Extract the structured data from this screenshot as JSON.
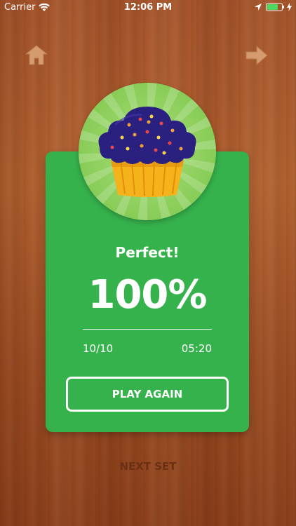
{
  "status_bar": {
    "carrier": "Carrier",
    "time": "12:06 PM",
    "battery_level": 0.85,
    "icons": [
      "wifi-icon",
      "location-icon",
      "battery-icon",
      "charging-icon"
    ]
  },
  "nav": {
    "home_icon": "home-icon",
    "next_icon": "arrow-right-icon"
  },
  "badge": {
    "icon": "cupcake-icon"
  },
  "result": {
    "label": "Perfect!",
    "score": "100%",
    "correct": "10/10",
    "time": "05:20"
  },
  "actions": {
    "play_again": "PLAY AGAIN",
    "next_set": "NEXT SET"
  },
  "colors": {
    "card": "#36b24c",
    "badge": "#8fd05e",
    "frosting": "#2a2080",
    "cup": "#f6b21a",
    "wood": "#a4532a",
    "next_set_text": "#6b2f12"
  }
}
